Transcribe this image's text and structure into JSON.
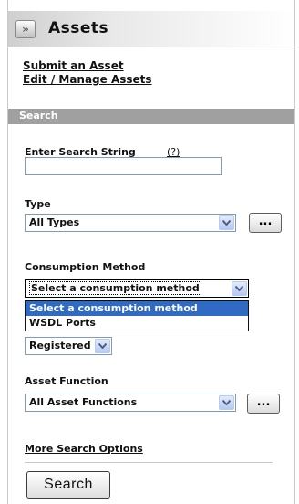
{
  "header": {
    "title": "Assets",
    "toggle_icon": "double-chevron-right-icon"
  },
  "nav": {
    "submit_asset": "Submit an Asset",
    "edit_manage_assets": "Edit / Manage Assets"
  },
  "search_section": {
    "title": "Search",
    "search_string_label": "Enter Search String",
    "help_link": "(?)",
    "search_string_value": "",
    "type_label": "Type",
    "type_value": "All Types",
    "type_browse_label": "...",
    "consumption_label": "Consumption Method",
    "consumption_value": "Select a consumption method",
    "consumption_options": [
      "Select a consumption method",
      "WSDL Ports"
    ],
    "registered_value": "Registered",
    "asset_function_label": "Asset Function",
    "asset_function_value": "All Asset Functions",
    "asset_function_browse_label": "...",
    "more_options": "More Search Options",
    "search_button": "Search"
  },
  "colors": {
    "section_bar": "#a0a0a0",
    "dropdown_highlight": "#316ac5",
    "input_border": "#7f9db9"
  }
}
